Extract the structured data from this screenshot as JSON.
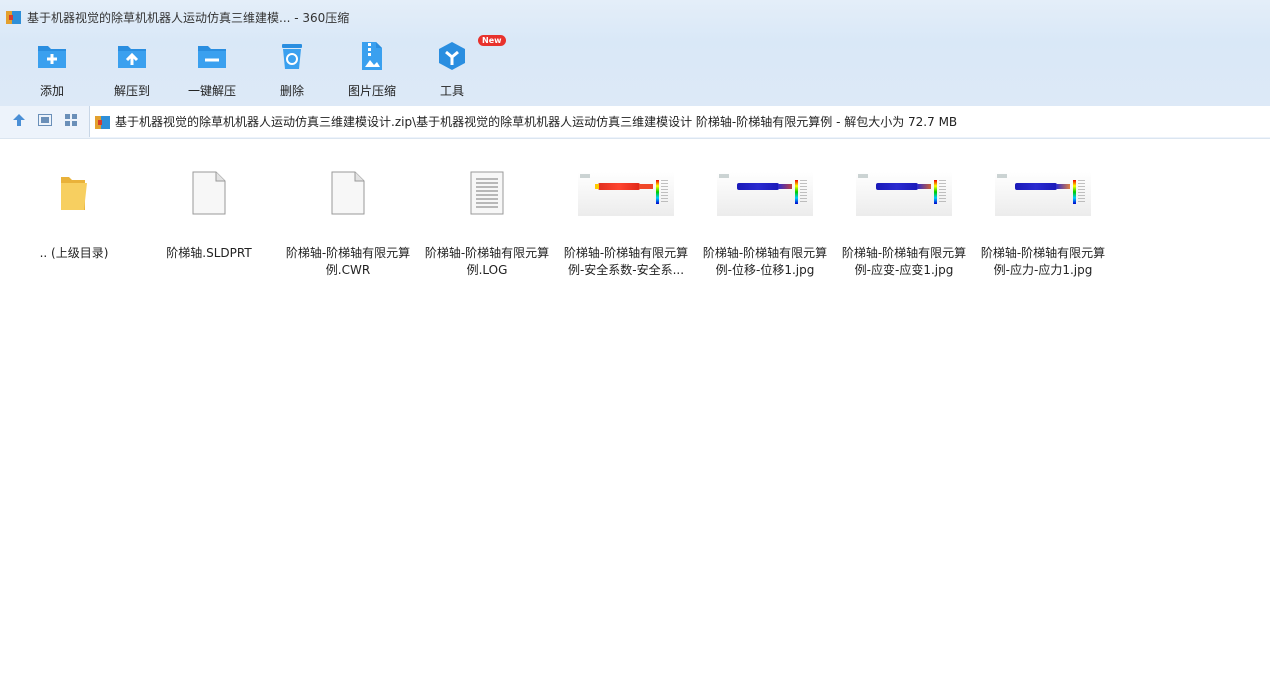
{
  "window": {
    "title": "基于机器视觉的除草机机器人运动仿真三维建模... - 360压缩"
  },
  "toolbar": {
    "items": [
      {
        "label": "添加",
        "icon": "add-folder-icon"
      },
      {
        "label": "解压到",
        "icon": "extract-to-icon"
      },
      {
        "label": "一键解压",
        "icon": "one-click-extract-icon"
      },
      {
        "label": "删除",
        "icon": "trash-icon"
      },
      {
        "label": "图片压缩",
        "icon": "image-compress-icon"
      },
      {
        "label": "工具",
        "icon": "tools-icon",
        "badge": "New"
      }
    ]
  },
  "nav": {
    "up": "up-arrow-icon",
    "view_detail": "detail-view-icon",
    "view_grid": "grid-view-icon"
  },
  "address": {
    "path": "基于机器视觉的除草机机器人运动仿真三维建模设计.zip\\基于机器视觉的除草机机器人运动仿真三维建模设计 阶梯轴-阶梯轴有限元算例 - 解包大小为 72.7 MB"
  },
  "files": [
    {
      "name": ".. (上级目录)",
      "type": "folder"
    },
    {
      "name": "阶梯轴.SLDPRT",
      "type": "file"
    },
    {
      "name": "阶梯轴-阶梯轴有限元算例.CWR",
      "type": "file"
    },
    {
      "name": "阶梯轴-阶梯轴有限元算例.LOG",
      "type": "text"
    },
    {
      "name": "阶梯轴-阶梯轴有限元算例-安全系数-安全系...",
      "type": "image"
    },
    {
      "name": "阶梯轴-阶梯轴有限元算例-位移-位移1.jpg",
      "type": "image"
    },
    {
      "name": "阶梯轴-阶梯轴有限元算例-应变-应变1.jpg",
      "type": "image"
    },
    {
      "name": "阶梯轴-阶梯轴有限元算例-应力-应力1.jpg",
      "type": "image"
    }
  ],
  "colors": {
    "accent": "#2f8fd8",
    "badge": "#e8322c",
    "folder": "#f3c24f"
  }
}
